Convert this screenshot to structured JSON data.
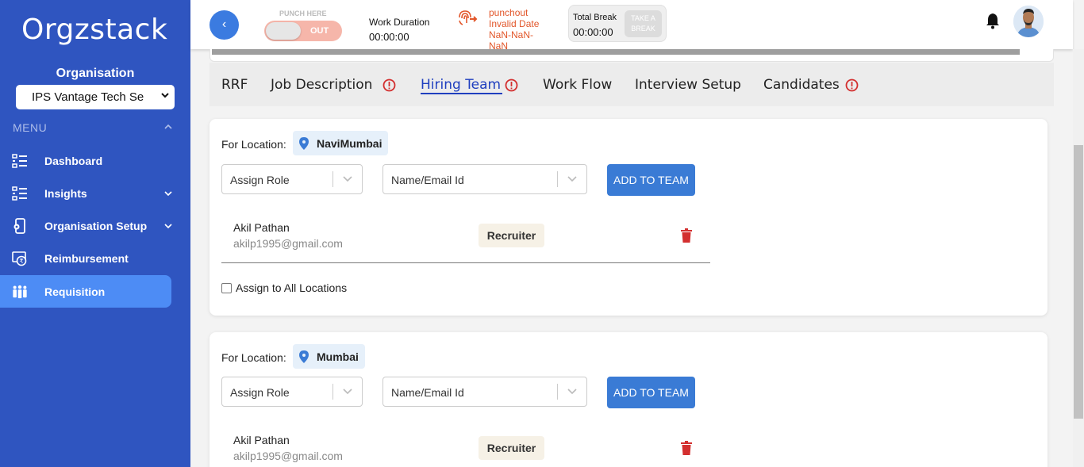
{
  "sidebar": {
    "logo": "Orgzstack",
    "org_label": "Organisation",
    "org_selected": "IPS Vantage Tech Se",
    "menu_label": "MENU",
    "items": [
      {
        "label": "Dashboard",
        "icon": "dashboard-icon",
        "active": false,
        "has_submenu": false
      },
      {
        "label": "Insights",
        "icon": "insights-icon",
        "active": false,
        "has_submenu": true
      },
      {
        "label": "Organisation Setup",
        "icon": "organisation-setup-icon",
        "active": false,
        "has_submenu": true
      },
      {
        "label": "Reimbursement",
        "icon": "reimbursement-icon",
        "active": false,
        "has_submenu": false
      },
      {
        "label": "Requisition",
        "icon": "requisition-icon",
        "active": true,
        "has_submenu": false
      }
    ]
  },
  "header": {
    "back_icon": "‹",
    "punch_label": "PUNCH HERE",
    "punch_state": "OUT",
    "work_duration_label": "Work Duration",
    "work_duration_value": "00:00:00",
    "punchout_label": "punchout",
    "punchout_date": "Invalid Date",
    "punchout_time_1": "NaN-NaN-",
    "punchout_time_2": "NaN",
    "total_break_label": "Total Break",
    "total_break_value": "00:00:00",
    "take_break_1": "TAKE A",
    "take_break_2": "BREAK"
  },
  "tabs": [
    {
      "label": "RRF",
      "warning": false,
      "active": false
    },
    {
      "label": "Job Description",
      "warning": true,
      "active": false
    },
    {
      "label": "Hiring Team",
      "warning": true,
      "active": true
    },
    {
      "label": "Work Flow",
      "warning": false,
      "active": false
    },
    {
      "label": "Interview Setup",
      "warning": false,
      "active": false
    },
    {
      "label": "Candidates",
      "warning": true,
      "active": false
    }
  ],
  "locations": [
    {
      "label": "For Location:",
      "name": "NaviMumbai",
      "role_placeholder": "Assign Role",
      "member_placeholder": "Name/Email Id",
      "add_button": "ADD TO TEAM",
      "member_name": "Akil Pathan",
      "member_email": "akilp1995@gmail.com",
      "member_role": "Recruiter",
      "assign_all_label": "Assign to All Locations"
    },
    {
      "label": "For Location:",
      "name": "Mumbai",
      "role_placeholder": "Assign Role",
      "member_placeholder": "Name/Email Id",
      "add_button": "ADD TO TEAM",
      "member_name": "Akil Pathan",
      "member_email": "akilp1995@gmail.com",
      "member_role": "Recruiter"
    }
  ],
  "colors": {
    "sidebar": "#2f55c0",
    "active_nav": "#4d8cf5",
    "primary_button": "#3a7bd5",
    "warning": "#d32f2f",
    "punchout": "#e2572b"
  }
}
